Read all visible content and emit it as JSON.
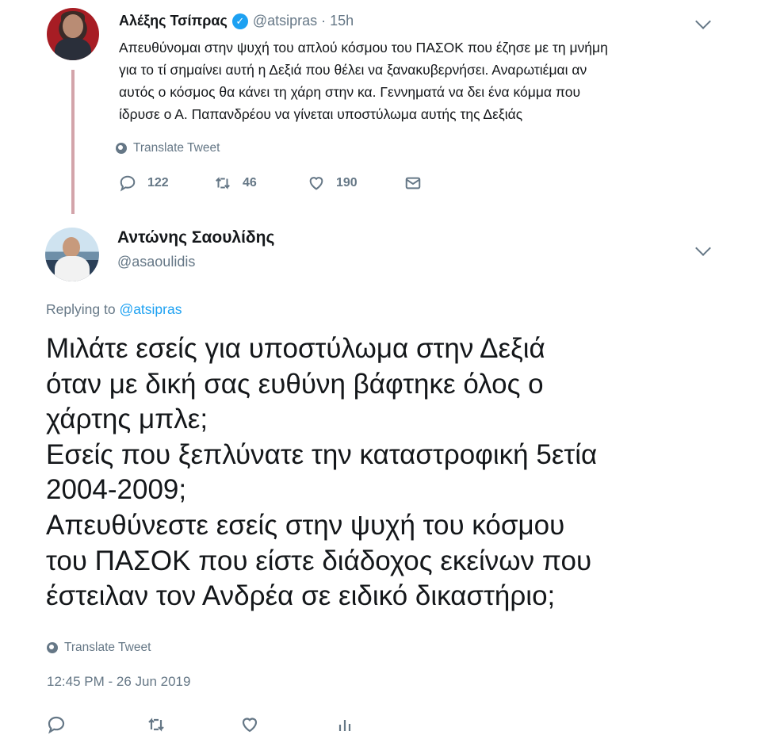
{
  "parent_tweet": {
    "name": "Αλέξης Τσίπρας",
    "verified_icon": "verified-badge-icon",
    "handle": "@atsipras",
    "separator": "·",
    "time": "15h",
    "text_lines": [
      "Απευθύνομαι στην ψυχή του απλού κόσμου του ΠΑΣΟΚ που έζησε με τη μνήμη",
      "για το τί σημαίνει αυτή η Δεξιά που θέλει να ξανακυβερνήσει. Αναρωτιέμαι αν",
      "αυτός ο κόσμος θα κάνει τη χάρη στην κα. Γεννηματά να δει ένα κόμμα που",
      "ίδρυσε ο Α. Παπανδρέου να γίνεται υποστύλωμα αυτής της Δεξιάς"
    ],
    "translate_label": "Translate Tweet",
    "actions": {
      "reply_count": "122",
      "retweet_count": "46",
      "like_count": "190"
    }
  },
  "reply_tweet": {
    "name": "Αντώνης Σαουλίδης",
    "handle": "@asaoulidis",
    "replying_prefix": "Replying to",
    "replying_mention": "@atsipras",
    "text_lines": [
      "Μιλάτε εσείς για υποστύλωμα στην Δεξιά",
      "όταν με δική σας ευθύνη βάφτηκε όλος ο",
      "χάρτης μπλε;",
      "Εσείς που ξεπλύνατε την καταστροφική 5ετία",
      "2004-2009;",
      "Απευθύνεστε εσείς στην ψυχή του κόσμου",
      "του ΠΑΣΟΚ που είστε διάδοχος εκείνων που",
      "έστειλαν τον Ανδρέα σε ειδικό δικαστήριο;"
    ],
    "translate_label": "Translate Tweet",
    "timestamp": "12:45 PM - 26 Jun 2019"
  },
  "colors": {
    "text": "#14171a",
    "muted": "#657786",
    "link": "#1da1f2",
    "thread_line": "#d3a4aa"
  }
}
